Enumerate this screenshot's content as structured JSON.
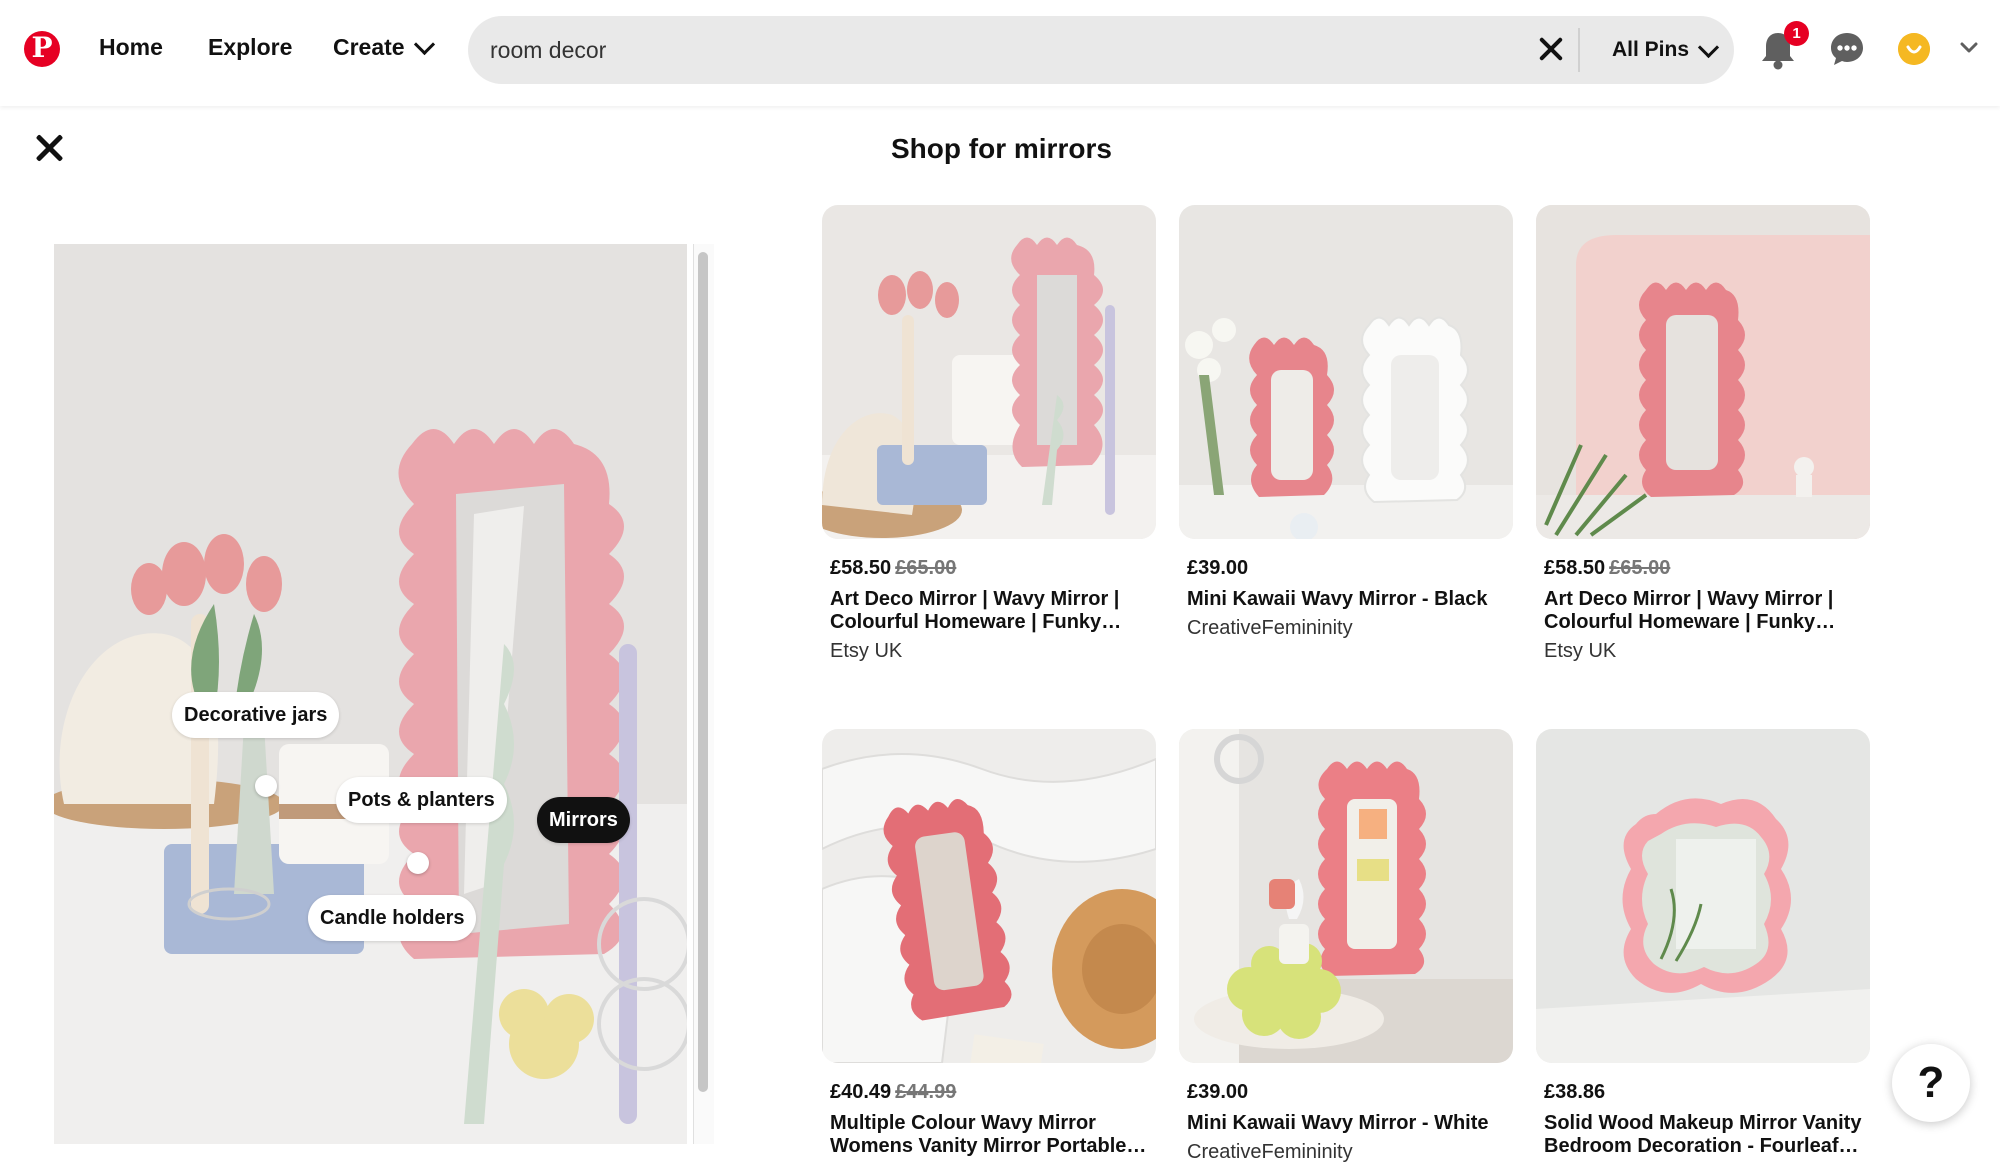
{
  "header": {
    "logo": "P",
    "nav": {
      "home": "Home",
      "explore": "Explore",
      "create": "Create"
    },
    "search": {
      "value": "room decor",
      "filter": "All Pins"
    },
    "notifications_count": "1",
    "icons": [
      "pinterest-logo",
      "chevron-down-icon",
      "close-icon",
      "bell-icon",
      "speech-bubble-icon",
      "avatar",
      "chevron-down-icon"
    ],
    "colors": {
      "brand": "#e60023",
      "avatar": "#f5b822"
    }
  },
  "closeup": {
    "tags": [
      {
        "label": "Decorative jars"
      },
      {
        "label": "Pots & planters"
      },
      {
        "label": "Mirrors",
        "selected": true
      },
      {
        "label": "Candle holders"
      }
    ]
  },
  "shop": {
    "title": "Shop for mirrors",
    "products": [
      {
        "price": "£58.50",
        "old_price": "£65.00",
        "name": "Art Deco Mirror | Wavy Mirror | Colourful Homeware | Funky Mirror",
        "merchant": "Etsy UK"
      },
      {
        "price": "£39.00",
        "old_price": "",
        "name": "Mini Kawaii Wavy Mirror - Black",
        "merchant": "CreativeFemininity"
      },
      {
        "price": "£58.50",
        "old_price": "£65.00",
        "name": "Art Deco Mirror | Wavy Mirror | Colourful Homeware | Funky Mirror",
        "merchant": "Etsy UK"
      },
      {
        "price": "£40.49",
        "old_price": "£44.99",
        "name": "Multiple Colour Wavy Mirror Womens Vanity Mirror Portable Mirror",
        "merchant": ""
      },
      {
        "price": "£39.00",
        "old_price": "",
        "name": "Mini Kawaii Wavy Mirror - White",
        "merchant": "CreativeFemininity"
      },
      {
        "price": "£38.86",
        "old_price": "",
        "name": "Solid Wood Makeup Mirror Vanity Bedroom Decoration - Fourleaf Clover",
        "merchant": ""
      }
    ]
  },
  "help": {
    "label": "?"
  }
}
